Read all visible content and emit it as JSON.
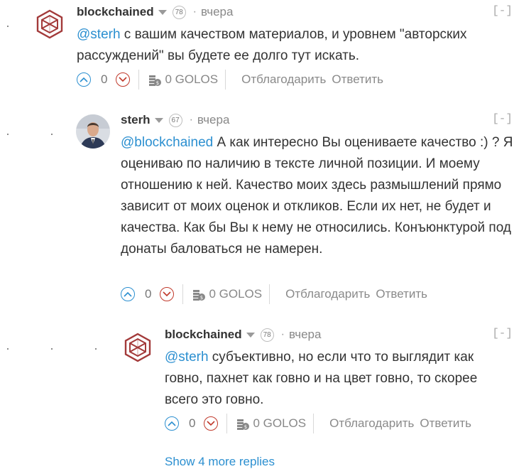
{
  "comments": [
    {
      "author": "blockchained",
      "rep": "78",
      "time": "вчера",
      "collapse": "[-]",
      "mention": "@sterh",
      "text": " с вашим качеством материалов, и уровнем \"авторских рассуждений\" вы будете ее долго тут искать.",
      "votes": "0",
      "payout": "0 GOLOS",
      "thank": "Отблагодарить",
      "reply": "Ответить"
    },
    {
      "author": "sterh",
      "rep": "67",
      "time": "вчера",
      "collapse": "[-]",
      "mention": "@blockchained",
      "text": " А как интересно Вы оцениваете качество :) ? Я оцениваю по наличию в тексте личной позиции. И моему отношению к ней. Качество моих здесь размышлений прямо зависит от моих оценок и откликов. Если их нет, не будет и качества. Как бы Вы к нему не относились. Конъюнктурой под донаты баловаться не намерен.",
      "votes": "0",
      "payout": "0 GOLOS",
      "thank": "Отблагодарить",
      "reply": "Ответить"
    },
    {
      "author": "blockchained",
      "rep": "78",
      "time": "вчера",
      "collapse": "[-]",
      "mention": "@sterh",
      "text": " субъективно, но если что то выглядит как говно, пахнет как говно и на цвет говно, то скорее всего это говно.",
      "votes": "0",
      "payout": "0 GOLOS",
      "thank": "Отблагодарить",
      "reply": "Ответить"
    }
  ],
  "show_more": "Show 4 more replies",
  "colors": {
    "mention": "#2b8fd0",
    "upvote": "#2b8fd0",
    "downvote": "#c0392b",
    "logo": "#a33a3a"
  }
}
